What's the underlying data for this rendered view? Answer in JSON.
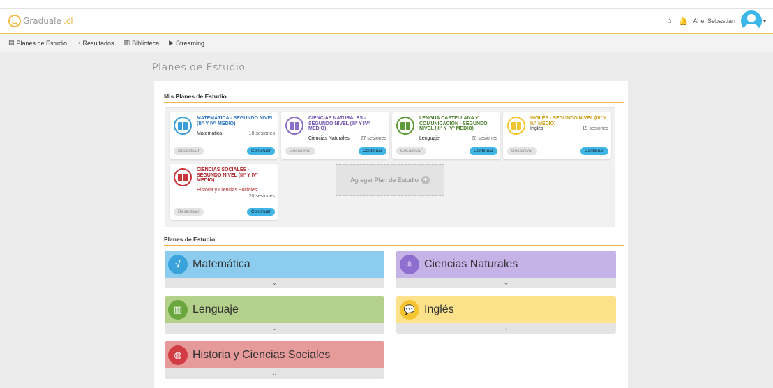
{
  "brand": {
    "name": "Graduale",
    "tld": ".cl"
  },
  "user": {
    "name": "Ariel Sebastian"
  },
  "nav": [
    {
      "label": "Planes de Estudio",
      "icon": "book-stack-icon"
    },
    {
      "label": "Resultados",
      "icon": "chart-icon"
    },
    {
      "label": "Biblioteca",
      "icon": "library-icon"
    },
    {
      "label": "Streaming",
      "icon": "video-icon"
    }
  ],
  "page": {
    "title": "Planes de Estudio"
  },
  "my_plans": {
    "heading": "Mis Planes de Estudio",
    "deactivate_label": "Desactivar",
    "continue_label": "Continuar",
    "add_label": "Agregar Plan de Estudio",
    "cards": [
      {
        "title": "MATEMÁTICA - SEGUNDO NIVEL (IIIº Y IVº MEDIO)",
        "subject": "Matemática",
        "sessions": "18 sesiones",
        "color": "#3a9fd8"
      },
      {
        "title": "CIENCIAS NATURALES - SEGUNDO NIVEL (IIIº Y IVº MEDIO)",
        "subject": "Ciencias Naturales",
        "sessions": "27 sesiones",
        "color": "#8b6fc9"
      },
      {
        "title": "LENGUA CASTELLANA Y COMUNICACIÓN - SEGUNDO NIVEL (IIIº Y IVº MEDIO)",
        "subject": "Lenguaje",
        "sessions": "20 sesiones",
        "color": "#5d9b3a"
      },
      {
        "title": "INGLÉS - SEGUNDO NIVEL (IIIº Y IVº MEDIO)",
        "subject": "Inglés",
        "sessions": "19 sesiones",
        "color": "#d6a90f"
      },
      {
        "title": "CIENCIAS SOCIALES - SEGUNDO NIVEL (IIIº Y IVº MEDIO)",
        "subject": "Historia y Ciencias Sociales",
        "sessions": "20 sesiones",
        "color": "#c8363c"
      }
    ]
  },
  "plans": {
    "heading": "Planes de Estudio",
    "subjects": [
      {
        "label": "Matemática",
        "icon": "sqrt-icon",
        "band": "#8ccdef",
        "circle": "#3aa3dc"
      },
      {
        "label": "Ciencias Naturales",
        "icon": "atom-icon",
        "band": "#c5b3e8",
        "circle": "#8e6fd0"
      },
      {
        "label": "Lenguaje",
        "icon": "open-book-icon",
        "band": "#b3d18a",
        "circle": "#6aa73e"
      },
      {
        "label": "Inglés",
        "icon": "speech-bubble-icon",
        "band": "#fbe28b",
        "circle": "#f7c531"
      },
      {
        "label": "Historia y Ciencias Sociales",
        "icon": "globe-icon",
        "band": "#e79a9a",
        "circle": "#d23c43"
      }
    ]
  }
}
